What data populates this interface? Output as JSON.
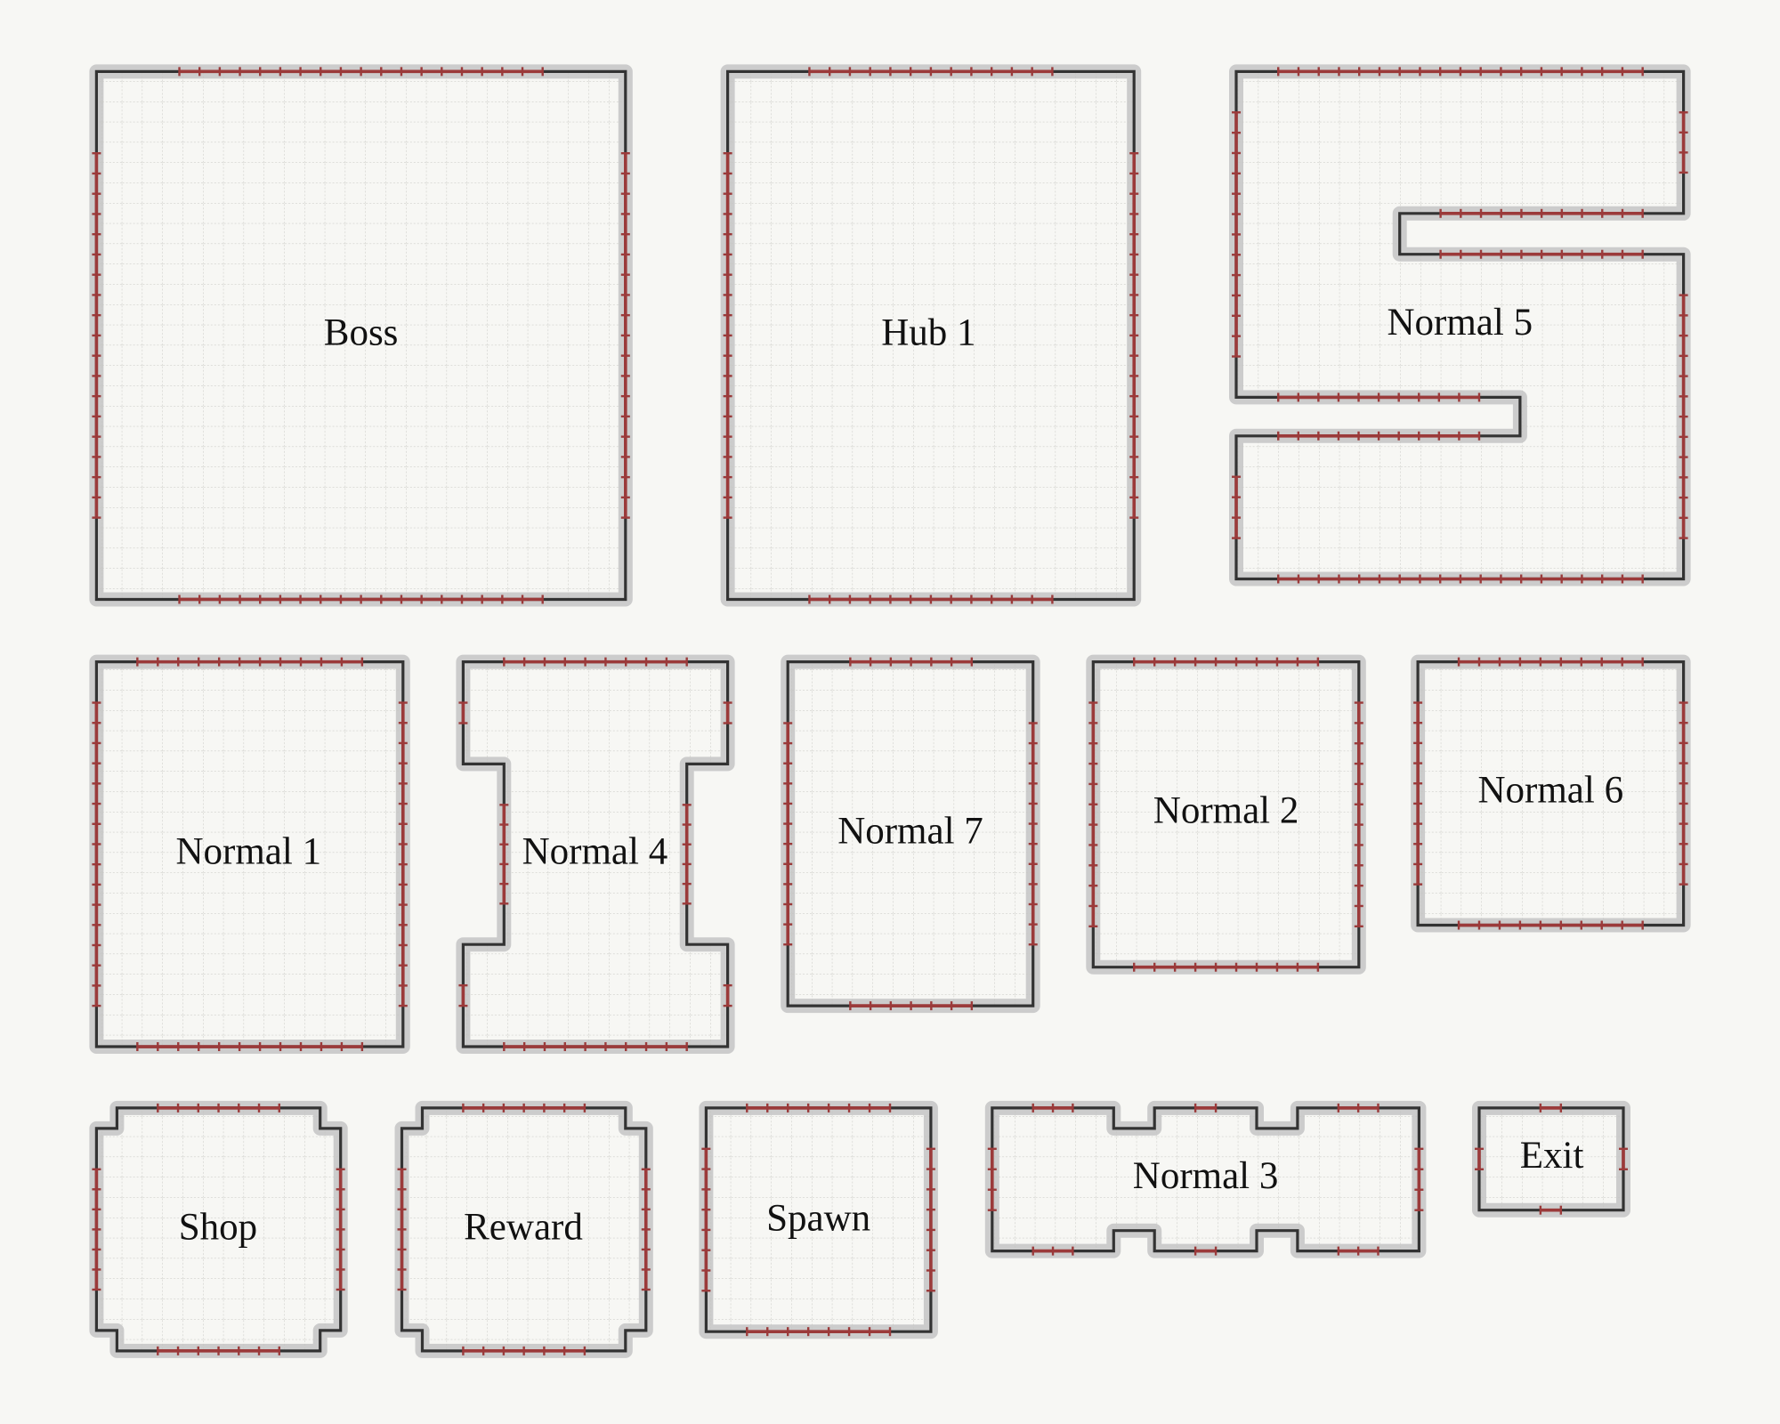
{
  "colors": {
    "background": "#f7f7f4",
    "outline_halo": "#cccccc",
    "wall": "#333333",
    "door_mark": "#9b3a3a",
    "grid_line": "#c4c4bf",
    "room_fill": "#f7f7f4"
  },
  "rooms": [
    {
      "id": "boss",
      "label": "Boss"
    },
    {
      "id": "hub-1",
      "label": "Hub 1"
    },
    {
      "id": "normal-5",
      "label": "Normal 5"
    },
    {
      "id": "normal-1",
      "label": "Normal 1"
    },
    {
      "id": "normal-4",
      "label": "Normal 4"
    },
    {
      "id": "normal-7",
      "label": "Normal 7"
    },
    {
      "id": "normal-2",
      "label": "Normal 2"
    },
    {
      "id": "normal-6",
      "label": "Normal 6"
    },
    {
      "id": "shop",
      "label": "Shop"
    },
    {
      "id": "reward",
      "label": "Reward"
    },
    {
      "id": "spawn",
      "label": "Spawn"
    },
    {
      "id": "normal-3",
      "label": "Normal 3"
    },
    {
      "id": "exit",
      "label": "Exit"
    }
  ]
}
